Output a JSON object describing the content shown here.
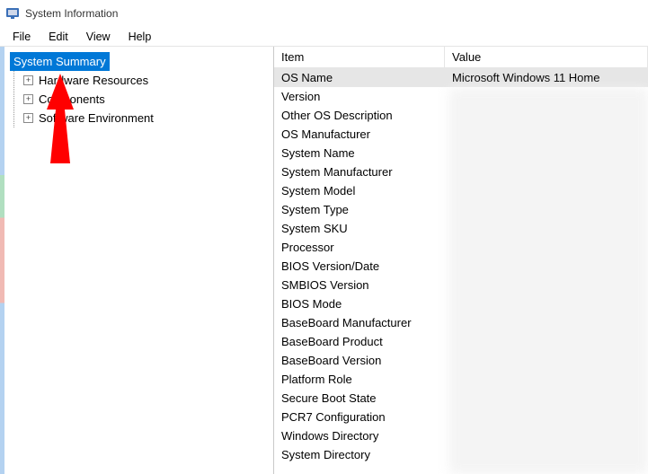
{
  "window": {
    "title": "System Information"
  },
  "menu": {
    "file": "File",
    "edit": "Edit",
    "view": "View",
    "help": "Help"
  },
  "tree": {
    "summary": "System Summary",
    "hardware": "Hardware Resources",
    "components": "Components",
    "software": "Software Environment"
  },
  "grid": {
    "header_item": "Item",
    "header_value": "Value",
    "rows": [
      {
        "item": "OS Name",
        "value": "Microsoft Windows 11 Home"
      },
      {
        "item": "Version",
        "value": ""
      },
      {
        "item": "Other OS Description",
        "value": ""
      },
      {
        "item": "OS Manufacturer",
        "value": ""
      },
      {
        "item": "System Name",
        "value": ""
      },
      {
        "item": "System Manufacturer",
        "value": ""
      },
      {
        "item": "System Model",
        "value": ""
      },
      {
        "item": "System Type",
        "value": ""
      },
      {
        "item": "System SKU",
        "value": ""
      },
      {
        "item": "Processor",
        "value": ""
      },
      {
        "item": "BIOS Version/Date",
        "value": ""
      },
      {
        "item": "SMBIOS Version",
        "value": ""
      },
      {
        "item": "BIOS Mode",
        "value": ""
      },
      {
        "item": "BaseBoard Manufacturer",
        "value": ""
      },
      {
        "item": "BaseBoard Product",
        "value": ""
      },
      {
        "item": "BaseBoard Version",
        "value": ""
      },
      {
        "item": "Platform Role",
        "value": ""
      },
      {
        "item": "Secure Boot State",
        "value": ""
      },
      {
        "item": "PCR7 Configuration",
        "value": ""
      },
      {
        "item": "Windows Directory",
        "value": ""
      },
      {
        "item": "System Directory",
        "value": ""
      }
    ]
  },
  "annotation": {
    "arrow_color": "#ff0000"
  }
}
